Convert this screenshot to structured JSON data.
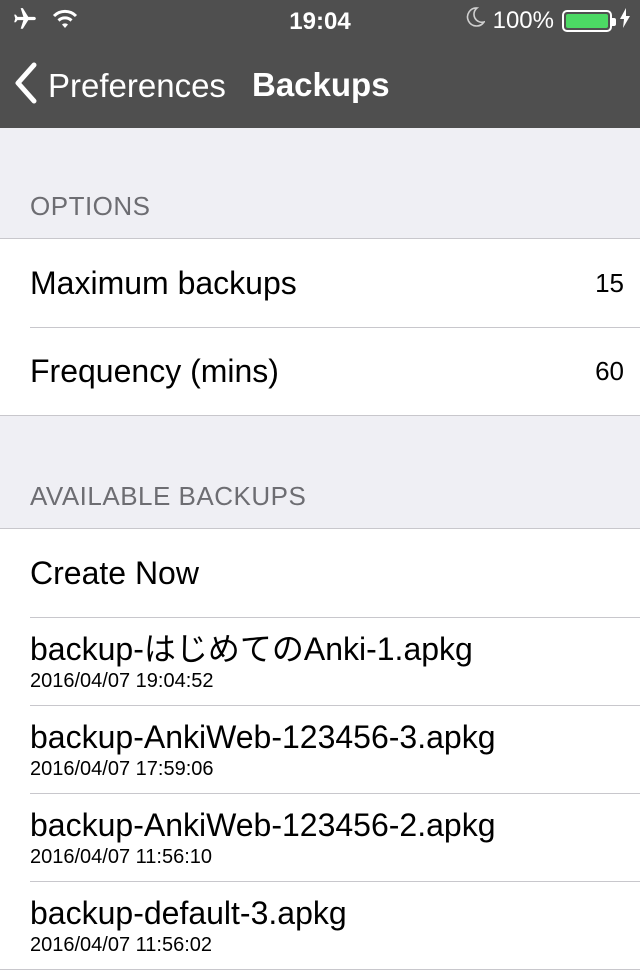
{
  "status_bar": {
    "time": "19:04",
    "battery_percent": "100%",
    "battery_level": 1.0,
    "battery_color": "#4cd964",
    "icons": [
      "airplane-icon",
      "wifi-icon",
      "moon-icon",
      "battery-icon",
      "charging-bolt-icon"
    ]
  },
  "nav": {
    "back_label": "Preferences",
    "title": "Backups"
  },
  "options": {
    "header": "OPTIONS",
    "rows": [
      {
        "label": "Maximum backups",
        "value": "15"
      },
      {
        "label": "Frequency (mins)",
        "value": "60"
      }
    ]
  },
  "available_backups": {
    "header": "AVAILABLE BACKUPS",
    "create_now_label": "Create Now",
    "items": [
      {
        "file": "backup-はじめてのAnki-1.apkg",
        "date": "2016/04/07 19:04:52"
      },
      {
        "file": "backup-AnkiWeb-123456-3.apkg",
        "date": "2016/04/07 17:59:06"
      },
      {
        "file": "backup-AnkiWeb-123456-2.apkg",
        "date": "2016/04/07 11:56:10"
      },
      {
        "file": "backup-default-3.apkg",
        "date": "2016/04/07 11:56:02"
      }
    ]
  },
  "colors": {
    "bar_background": "#4f4f4f",
    "page_background": "#efeff4",
    "section_header_text": "#6d6d72",
    "separator": "#c8c7cc"
  }
}
